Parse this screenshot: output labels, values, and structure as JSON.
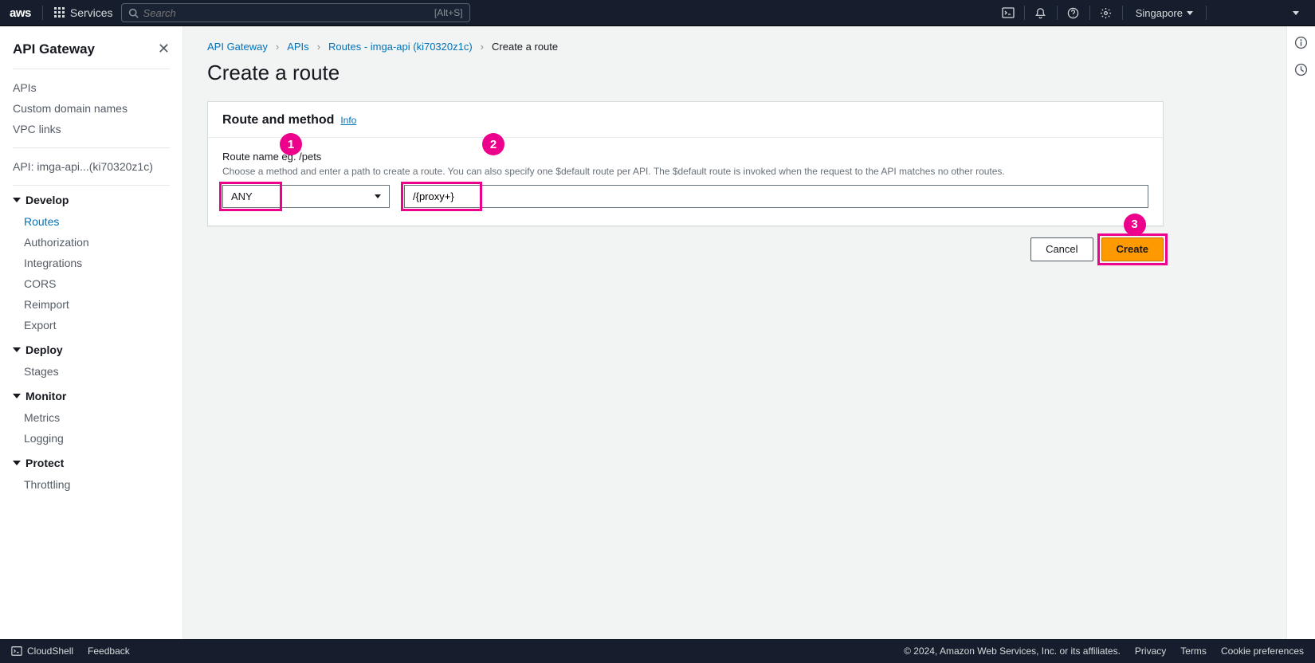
{
  "topnav": {
    "logo": "aws",
    "services": "Services",
    "search_placeholder": "Search",
    "search_hint": "[Alt+S]",
    "region": "Singapore"
  },
  "sidebar": {
    "title": "API Gateway",
    "section1": [
      {
        "label": "APIs"
      },
      {
        "label": "Custom domain names"
      },
      {
        "label": "VPC links"
      }
    ],
    "api_ctx": "API: imga-api...(ki70320z1c)",
    "groups": [
      {
        "title": "Develop",
        "items": [
          {
            "label": "Routes",
            "active": true
          },
          {
            "label": "Authorization"
          },
          {
            "label": "Integrations"
          },
          {
            "label": "CORS"
          },
          {
            "label": "Reimport"
          },
          {
            "label": "Export"
          }
        ]
      },
      {
        "title": "Deploy",
        "items": [
          {
            "label": "Stages"
          }
        ]
      },
      {
        "title": "Monitor",
        "items": [
          {
            "label": "Metrics"
          },
          {
            "label": "Logging"
          }
        ]
      },
      {
        "title": "Protect",
        "items": [
          {
            "label": "Throttling"
          }
        ]
      }
    ]
  },
  "breadcrumb": [
    {
      "label": "API Gateway",
      "link": true
    },
    {
      "label": "APIs",
      "link": true
    },
    {
      "label": "Routes - imga-api (ki70320z1c)",
      "link": true
    },
    {
      "label": "Create a route",
      "link": false
    }
  ],
  "page": {
    "title": "Create a route",
    "panel_title": "Route and method",
    "info": "Info",
    "field_label": "Route name eg. /pets",
    "field_desc": "Choose a method and enter a path to create a route. You can also specify one $default route per API. The $default route is invoked when the request to the API matches no other routes.",
    "method_value": "ANY",
    "path_value": "/{proxy+}",
    "cancel": "Cancel",
    "create": "Create"
  },
  "annotations": {
    "b1": "1",
    "b2": "2",
    "b3": "3"
  },
  "footer": {
    "cloudshell": "CloudShell",
    "feedback": "Feedback",
    "copyright": "© 2024, Amazon Web Services, Inc. or its affiliates.",
    "privacy": "Privacy",
    "terms": "Terms",
    "cookies": "Cookie preferences"
  }
}
